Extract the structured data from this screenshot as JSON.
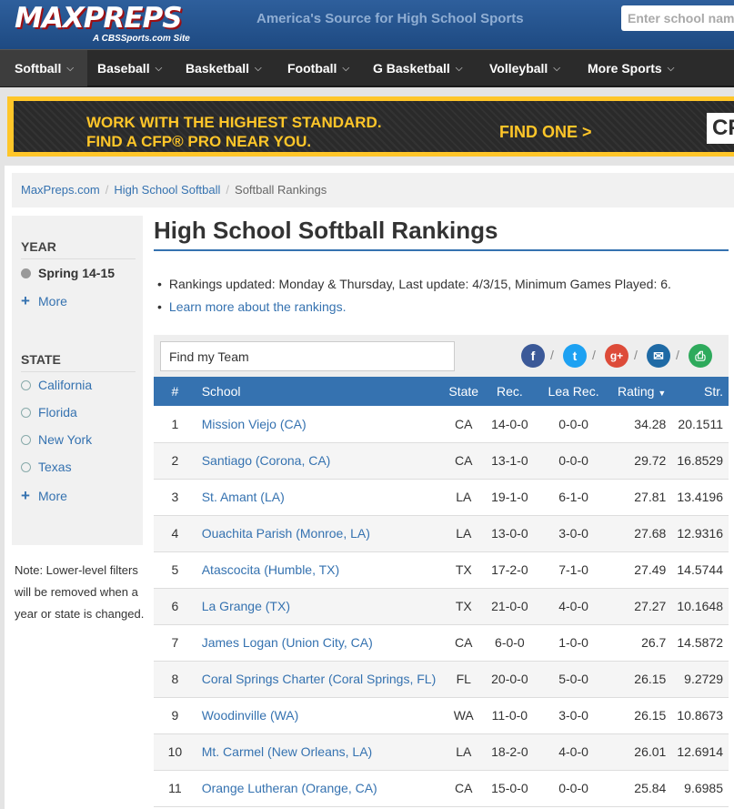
{
  "header": {
    "logo_text": "MAXPREPS",
    "logo_sub": "A CBSSports.com Site",
    "tagline": "America's Source for High School Sports",
    "search_placeholder": "Enter school name"
  },
  "nav": [
    {
      "label": "Softball",
      "active": true
    },
    {
      "label": "Baseball"
    },
    {
      "label": "Basketball"
    },
    {
      "label": "Football"
    },
    {
      "label": "G Basketball"
    },
    {
      "label": "Volleyball"
    },
    {
      "label": "More Sports"
    }
  ],
  "banner": {
    "line1": "WORK WITH THE HIGHEST STANDARD.",
    "line2": "FIND A CFP® PRO NEAR YOU.",
    "cta": "FIND ONE >",
    "logo": "CFP"
  },
  "breadcrumb": {
    "home": "MaxPreps.com",
    "section": "High School Softball",
    "current": "Softball Rankings"
  },
  "sidebar": {
    "year_heading": "YEAR",
    "year_selected": "Spring 14-15",
    "more": "More",
    "state_heading": "STATE",
    "states": [
      "California",
      "Florida",
      "New York",
      "Texas"
    ],
    "note": "Note: Lower-level filters will be removed when a year or state is changed."
  },
  "main": {
    "title": "High School Softball Rankings",
    "update_info": "Rankings updated: Monday & Thursday, Last update: 4/3/15, Minimum Games Played: 6.",
    "learn_more": "Learn more about the rankings.",
    "find_team_value": "Find my Team"
  },
  "share": {
    "facebook": "f",
    "twitter": "t",
    "google": "g+",
    "email": "✉",
    "print": "⎙",
    "separator": "/"
  },
  "table": {
    "headers": [
      "#",
      "School",
      "State",
      "Rec.",
      "Lea Rec.",
      "Rating",
      "Str."
    ],
    "rows": [
      [
        "1",
        "Mission Viejo (CA)",
        "CA",
        "14-0-0",
        "0-0-0",
        "34.28",
        "20.1511"
      ],
      [
        "2",
        "Santiago (Corona, CA)",
        "CA",
        "13-1-0",
        "0-0-0",
        "29.72",
        "16.8529"
      ],
      [
        "3",
        "St. Amant (LA)",
        "LA",
        "19-1-0",
        "6-1-0",
        "27.81",
        "13.4196"
      ],
      [
        "4",
        "Ouachita Parish (Monroe, LA)",
        "LA",
        "13-0-0",
        "3-0-0",
        "27.68",
        "12.9316"
      ],
      [
        "5",
        "Atascocita (Humble, TX)",
        "TX",
        "17-2-0",
        "7-1-0",
        "27.49",
        "14.5744"
      ],
      [
        "6",
        "La Grange (TX)",
        "TX",
        "21-0-0",
        "4-0-0",
        "27.27",
        "10.1648"
      ],
      [
        "7",
        "James Logan (Union City, CA)",
        "CA",
        "6-0-0",
        "1-0-0",
        "26.7",
        "14.5872"
      ],
      [
        "8",
        "Coral Springs Charter (Coral Springs, FL)",
        "FL",
        "20-0-0",
        "5-0-0",
        "26.15",
        "9.2729"
      ],
      [
        "9",
        "Woodinville (WA)",
        "WA",
        "11-0-0",
        "3-0-0",
        "26.15",
        "10.8673"
      ],
      [
        "10",
        "Mt. Carmel (New Orleans, LA)",
        "LA",
        "18-2-0",
        "4-0-0",
        "26.01",
        "12.6914"
      ],
      [
        "11",
        "Orange Lutheran (Orange, CA)",
        "CA",
        "15-0-0",
        "0-0-0",
        "25.84",
        "9.6985"
      ]
    ]
  },
  "colors": {
    "header_blue": "#1e4a82",
    "link_blue": "#3572b0",
    "banner_yellow": "#ffc629",
    "facebook": "#3b5998",
    "twitter": "#1da1f2",
    "google": "#dd4b39",
    "email": "#1f6aa5",
    "print": "#2eaa5c"
  }
}
